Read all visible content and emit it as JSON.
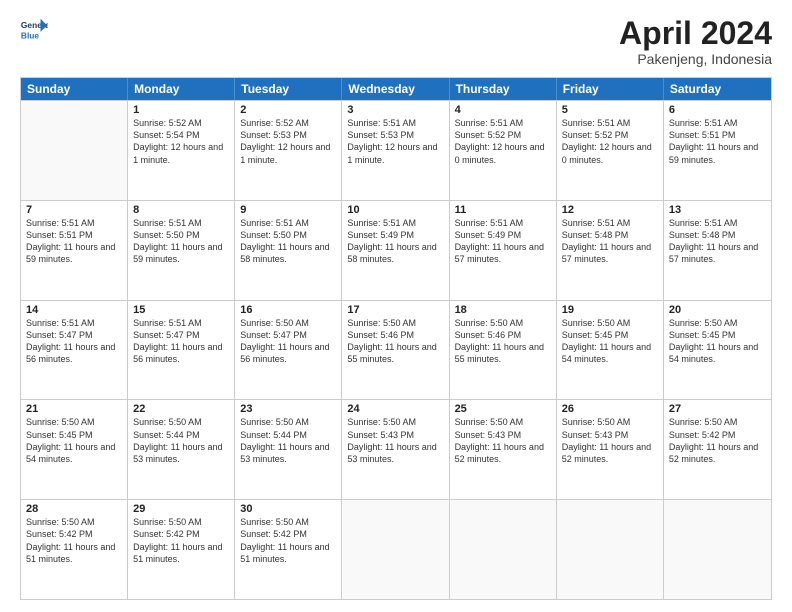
{
  "header": {
    "logo_line1": "General",
    "logo_line2": "Blue",
    "month_title": "April 2024",
    "location": "Pakenjeng, Indonesia"
  },
  "days_of_week": [
    "Sunday",
    "Monday",
    "Tuesday",
    "Wednesday",
    "Thursday",
    "Friday",
    "Saturday"
  ],
  "weeks": [
    [
      {
        "day": "",
        "sunrise": "",
        "sunset": "",
        "daylight": ""
      },
      {
        "day": "1",
        "sunrise": "Sunrise: 5:52 AM",
        "sunset": "Sunset: 5:54 PM",
        "daylight": "Daylight: 12 hours and 1 minute."
      },
      {
        "day": "2",
        "sunrise": "Sunrise: 5:52 AM",
        "sunset": "Sunset: 5:53 PM",
        "daylight": "Daylight: 12 hours and 1 minute."
      },
      {
        "day": "3",
        "sunrise": "Sunrise: 5:51 AM",
        "sunset": "Sunset: 5:53 PM",
        "daylight": "Daylight: 12 hours and 1 minute."
      },
      {
        "day": "4",
        "sunrise": "Sunrise: 5:51 AM",
        "sunset": "Sunset: 5:52 PM",
        "daylight": "Daylight: 12 hours and 0 minutes."
      },
      {
        "day": "5",
        "sunrise": "Sunrise: 5:51 AM",
        "sunset": "Sunset: 5:52 PM",
        "daylight": "Daylight: 12 hours and 0 minutes."
      },
      {
        "day": "6",
        "sunrise": "Sunrise: 5:51 AM",
        "sunset": "Sunset: 5:51 PM",
        "daylight": "Daylight: 11 hours and 59 minutes."
      }
    ],
    [
      {
        "day": "7",
        "sunrise": "Sunrise: 5:51 AM",
        "sunset": "Sunset: 5:51 PM",
        "daylight": "Daylight: 11 hours and 59 minutes."
      },
      {
        "day": "8",
        "sunrise": "Sunrise: 5:51 AM",
        "sunset": "Sunset: 5:50 PM",
        "daylight": "Daylight: 11 hours and 59 minutes."
      },
      {
        "day": "9",
        "sunrise": "Sunrise: 5:51 AM",
        "sunset": "Sunset: 5:50 PM",
        "daylight": "Daylight: 11 hours and 58 minutes."
      },
      {
        "day": "10",
        "sunrise": "Sunrise: 5:51 AM",
        "sunset": "Sunset: 5:49 PM",
        "daylight": "Daylight: 11 hours and 58 minutes."
      },
      {
        "day": "11",
        "sunrise": "Sunrise: 5:51 AM",
        "sunset": "Sunset: 5:49 PM",
        "daylight": "Daylight: 11 hours and 57 minutes."
      },
      {
        "day": "12",
        "sunrise": "Sunrise: 5:51 AM",
        "sunset": "Sunset: 5:48 PM",
        "daylight": "Daylight: 11 hours and 57 minutes."
      },
      {
        "day": "13",
        "sunrise": "Sunrise: 5:51 AM",
        "sunset": "Sunset: 5:48 PM",
        "daylight": "Daylight: 11 hours and 57 minutes."
      }
    ],
    [
      {
        "day": "14",
        "sunrise": "Sunrise: 5:51 AM",
        "sunset": "Sunset: 5:47 PM",
        "daylight": "Daylight: 11 hours and 56 minutes."
      },
      {
        "day": "15",
        "sunrise": "Sunrise: 5:51 AM",
        "sunset": "Sunset: 5:47 PM",
        "daylight": "Daylight: 11 hours and 56 minutes."
      },
      {
        "day": "16",
        "sunrise": "Sunrise: 5:50 AM",
        "sunset": "Sunset: 5:47 PM",
        "daylight": "Daylight: 11 hours and 56 minutes."
      },
      {
        "day": "17",
        "sunrise": "Sunrise: 5:50 AM",
        "sunset": "Sunset: 5:46 PM",
        "daylight": "Daylight: 11 hours and 55 minutes."
      },
      {
        "day": "18",
        "sunrise": "Sunrise: 5:50 AM",
        "sunset": "Sunset: 5:46 PM",
        "daylight": "Daylight: 11 hours and 55 minutes."
      },
      {
        "day": "19",
        "sunrise": "Sunrise: 5:50 AM",
        "sunset": "Sunset: 5:45 PM",
        "daylight": "Daylight: 11 hours and 54 minutes."
      },
      {
        "day": "20",
        "sunrise": "Sunrise: 5:50 AM",
        "sunset": "Sunset: 5:45 PM",
        "daylight": "Daylight: 11 hours and 54 minutes."
      }
    ],
    [
      {
        "day": "21",
        "sunrise": "Sunrise: 5:50 AM",
        "sunset": "Sunset: 5:45 PM",
        "daylight": "Daylight: 11 hours and 54 minutes."
      },
      {
        "day": "22",
        "sunrise": "Sunrise: 5:50 AM",
        "sunset": "Sunset: 5:44 PM",
        "daylight": "Daylight: 11 hours and 53 minutes."
      },
      {
        "day": "23",
        "sunrise": "Sunrise: 5:50 AM",
        "sunset": "Sunset: 5:44 PM",
        "daylight": "Daylight: 11 hours and 53 minutes."
      },
      {
        "day": "24",
        "sunrise": "Sunrise: 5:50 AM",
        "sunset": "Sunset: 5:43 PM",
        "daylight": "Daylight: 11 hours and 53 minutes."
      },
      {
        "day": "25",
        "sunrise": "Sunrise: 5:50 AM",
        "sunset": "Sunset: 5:43 PM",
        "daylight": "Daylight: 11 hours and 52 minutes."
      },
      {
        "day": "26",
        "sunrise": "Sunrise: 5:50 AM",
        "sunset": "Sunset: 5:43 PM",
        "daylight": "Daylight: 11 hours and 52 minutes."
      },
      {
        "day": "27",
        "sunrise": "Sunrise: 5:50 AM",
        "sunset": "Sunset: 5:42 PM",
        "daylight": "Daylight: 11 hours and 52 minutes."
      }
    ],
    [
      {
        "day": "28",
        "sunrise": "Sunrise: 5:50 AM",
        "sunset": "Sunset: 5:42 PM",
        "daylight": "Daylight: 11 hours and 51 minutes."
      },
      {
        "day": "29",
        "sunrise": "Sunrise: 5:50 AM",
        "sunset": "Sunset: 5:42 PM",
        "daylight": "Daylight: 11 hours and 51 minutes."
      },
      {
        "day": "30",
        "sunrise": "Sunrise: 5:50 AM",
        "sunset": "Sunset: 5:42 PM",
        "daylight": "Daylight: 11 hours and 51 minutes."
      },
      {
        "day": "",
        "sunrise": "",
        "sunset": "",
        "daylight": ""
      },
      {
        "day": "",
        "sunrise": "",
        "sunset": "",
        "daylight": ""
      },
      {
        "day": "",
        "sunrise": "",
        "sunset": "",
        "daylight": ""
      },
      {
        "day": "",
        "sunrise": "",
        "sunset": "",
        "daylight": ""
      }
    ]
  ]
}
